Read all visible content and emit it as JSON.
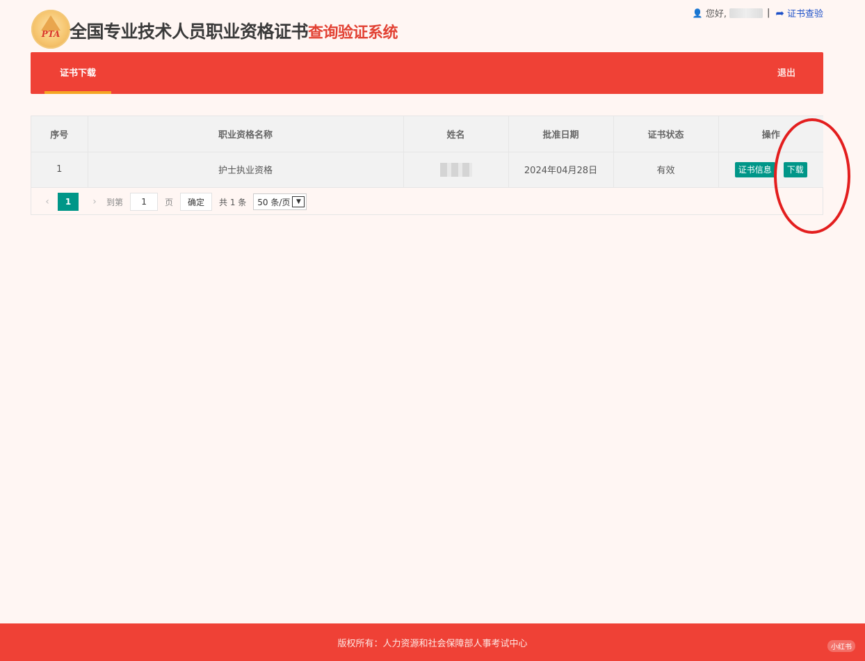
{
  "header": {
    "logo_text": "PTA",
    "title_main": "全国专业技术人员职业资格证书",
    "title_sub": "查询验证系统",
    "greeting": "您好,",
    "separator": "|",
    "verify_link": "证书查验"
  },
  "nav": {
    "tab_label": "证书下载",
    "logout_label": "退出"
  },
  "table": {
    "columns": [
      "序号",
      "职业资格名称",
      "姓名",
      "批准日期",
      "证书状态",
      "操作"
    ],
    "rows": [
      {
        "index": "1",
        "qualification": "护士执业资格",
        "date": "2024年04月28日",
        "status": "有效",
        "info_button": "证书信息",
        "download_button": "下载"
      }
    ]
  },
  "pager": {
    "prev": "‹",
    "current_page": "1",
    "next": "›",
    "goto_label": "到第",
    "goto_value": "1",
    "page_unit": "页",
    "confirm_label": "确定",
    "total_label": "共 1 条",
    "page_size": "50 条/页"
  },
  "footer": {
    "copyright": "版权所有：人力资源和社会保障部人事考试中心"
  },
  "watermark": "小红书",
  "colors": {
    "brand_red": "#ef4136",
    "accent_teal": "#009688",
    "tab_underline": "#f5a623",
    "annotation_red": "#e31e1e",
    "page_bg": "#fff6f3"
  }
}
